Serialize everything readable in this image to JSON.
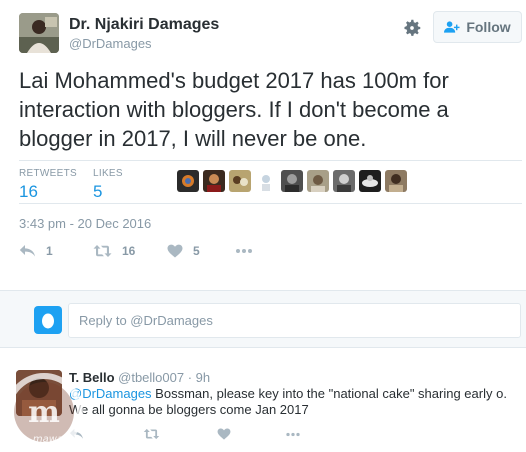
{
  "tweet": {
    "author_name": "Dr. Njakiri Damages",
    "author_handle": "@DrDamages",
    "follow_label": "Follow",
    "text": "Lai Mohammed's budget 2017 has 100m for interaction with bloggers. If I don't become a blogger in 2017, I will never be one.",
    "stats": {
      "retweets_label": "RETWEETS",
      "retweets_value": "16",
      "likes_label": "LIKES",
      "likes_value": "5"
    },
    "timestamp": "3:43 pm - 20 Dec 2016",
    "actions": {
      "reply_count": "1",
      "retweet_count": "16",
      "like_count": "5"
    }
  },
  "reply_box": {
    "placeholder": "Reply to @DrDamages"
  },
  "reply": {
    "author_name": "T. Bello",
    "author_handle": "@tbello007",
    "time": "· 9h",
    "mention": "@DrDamages",
    "text": " Bossman, please key into the \"national cake\" sharing early o. We all gonna be bloggers come Jan 2017"
  },
  "colors": {
    "link": "#1b95e0",
    "muted": "#8899a6",
    "text": "#292f33",
    "border": "#e1e8ed"
  },
  "watermark_text": "mawa"
}
